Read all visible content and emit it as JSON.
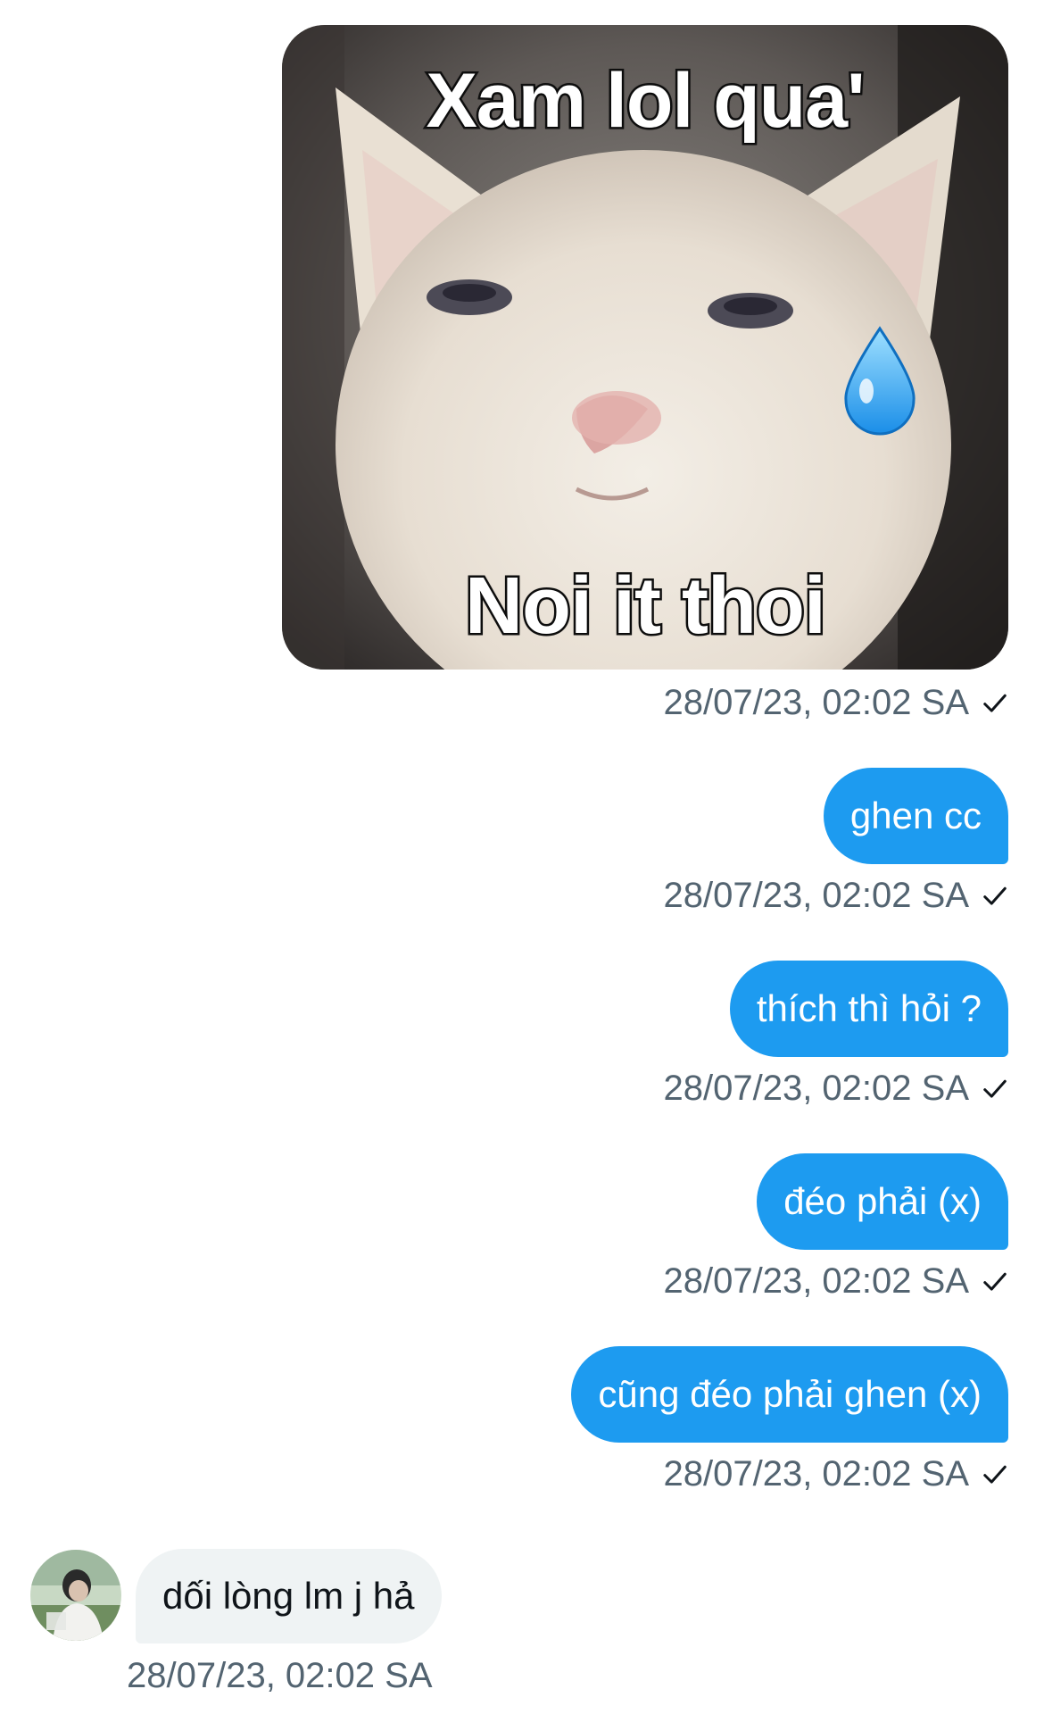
{
  "conversation": {
    "meme": {
      "top_caption": "Xam lol qua'",
      "bottom_caption": "Noi it thoi",
      "timestamp": "28/07/23, 02:02 SA",
      "status_icon": "check-icon"
    },
    "messages": [
      {
        "direction": "out",
        "text": "ghen cc",
        "timestamp": "28/07/23, 02:02 SA",
        "status_icon": "check-icon"
      },
      {
        "direction": "out",
        "text": "thích thì hỏi ?",
        "timestamp": "28/07/23, 02:02 SA",
        "status_icon": "check-icon"
      },
      {
        "direction": "out",
        "text": "đéo phải (x)",
        "timestamp": "28/07/23, 02:02 SA",
        "status_icon": "check-icon"
      },
      {
        "direction": "out",
        "text": "cũng đéo phải ghen (x)",
        "timestamp": "28/07/23, 02:02 SA",
        "status_icon": "check-icon"
      },
      {
        "direction": "in",
        "text": "dối lòng lm j hả",
        "timestamp": "28/07/23, 02:02 SA",
        "avatar_icon": "user-avatar"
      }
    ]
  },
  "colors": {
    "outgoing_bubble": "#1d9bf0",
    "incoming_bubble": "#eff3f4",
    "timestamp_text": "#536471",
    "background": "#ffffff"
  }
}
